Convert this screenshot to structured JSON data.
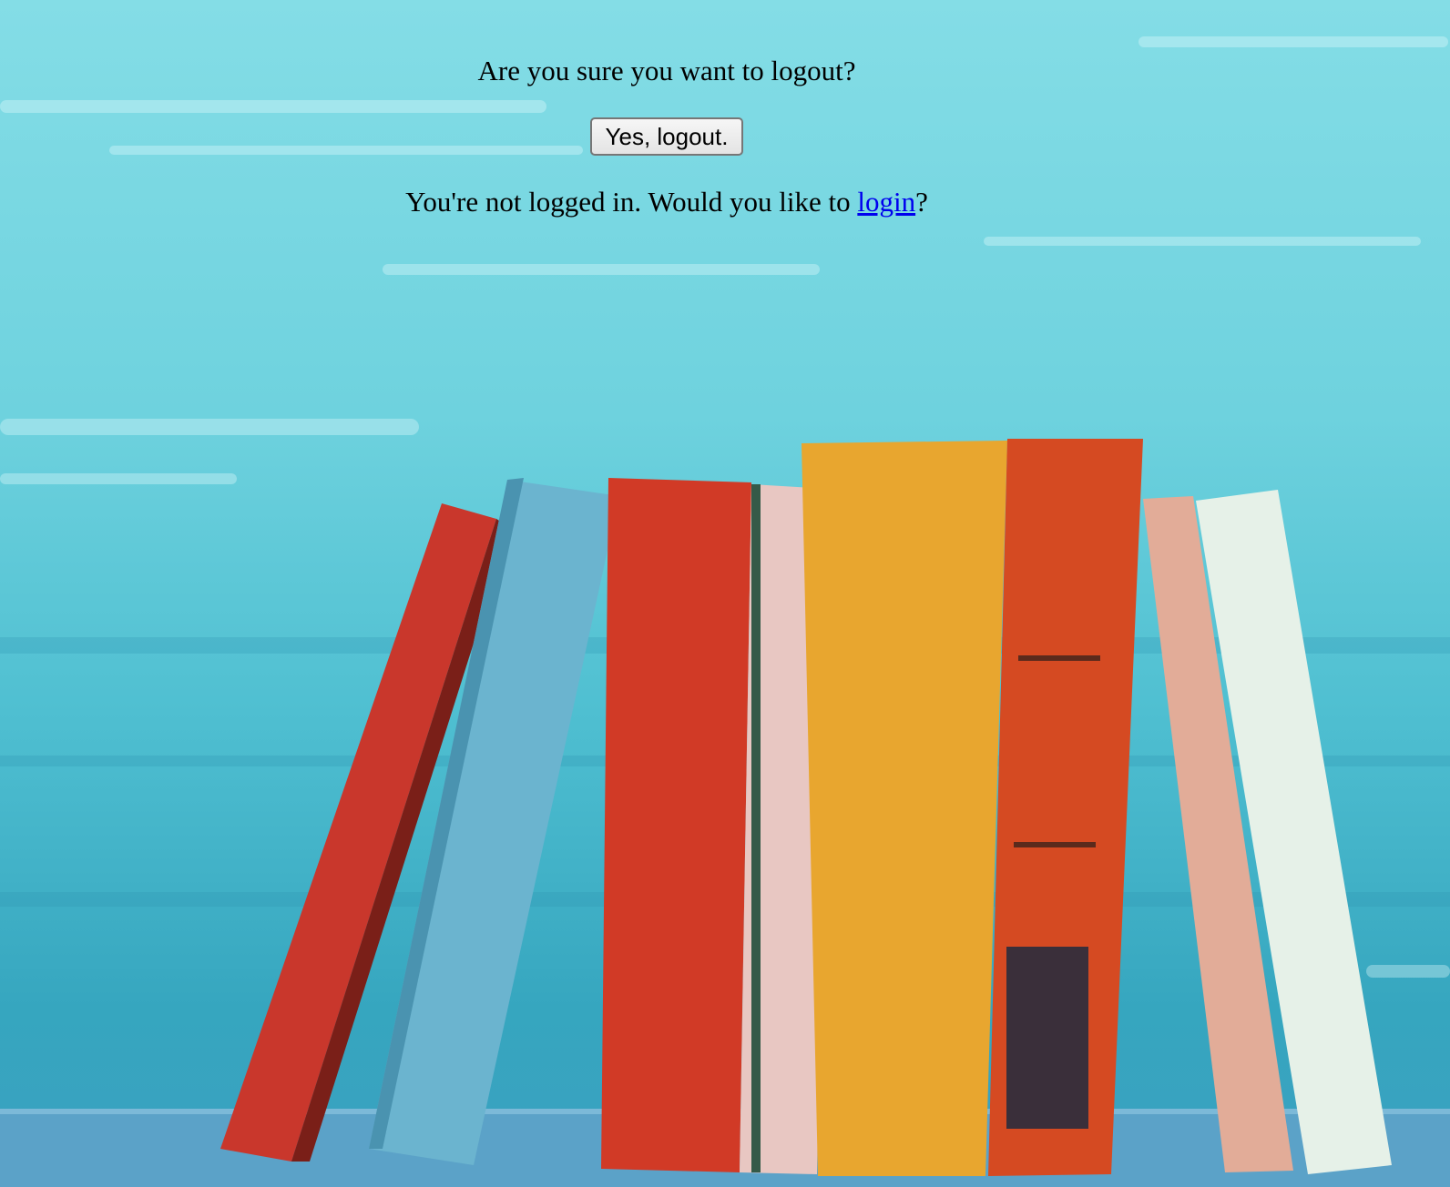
{
  "logout": {
    "question": "Are you sure you want to logout?",
    "confirm_label": "Yes, logout."
  },
  "status": {
    "prefix": "You're not logged in. Would you like to ",
    "login_link": "login",
    "suffix": "?"
  },
  "colors": {
    "background_top": "#7fdbe4",
    "background_bottom": "#3eb0c6",
    "link": "#0000ee"
  }
}
